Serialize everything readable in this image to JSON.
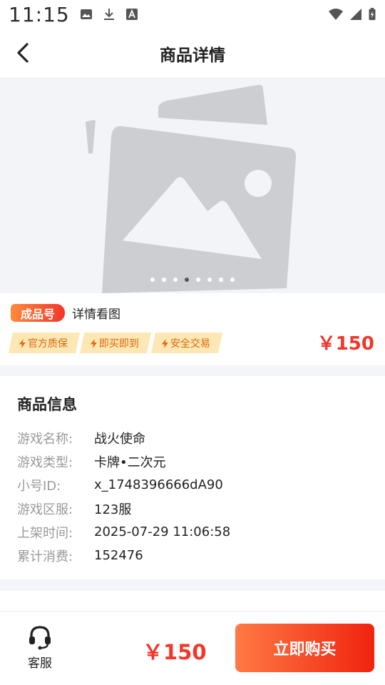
{
  "status_bar": {
    "time": "11:15"
  },
  "nav": {
    "title": "商品详情"
  },
  "carousel": {
    "slide_count": 8,
    "active_index": 3
  },
  "product": {
    "tag": "成品号",
    "detail_link": "详情看图",
    "badges": [
      "官方质保",
      "即买即到",
      "安全交易"
    ],
    "price": "￥150"
  },
  "info": {
    "title": "商品信息",
    "rows": [
      {
        "label": "游戏名称:",
        "value": "战火使命"
      },
      {
        "label": "游戏类型:",
        "value": "卡牌•二次元"
      },
      {
        "label": "小号ID:",
        "value": "x_1748396666dA90"
      },
      {
        "label": "游戏区服:",
        "value": "123服"
      },
      {
        "label": "上架时间:",
        "value": "2025-07-29 11:06:58"
      },
      {
        "label": "累计消费:",
        "value": "152476"
      }
    ]
  },
  "bottom_bar": {
    "service_label": "客服",
    "price": "￥150",
    "buy_label": "立即购买"
  },
  "colors": {
    "accent_red": "#f2362a",
    "badge_bg": "#fde7b5",
    "badge_text": "#d9690b"
  }
}
